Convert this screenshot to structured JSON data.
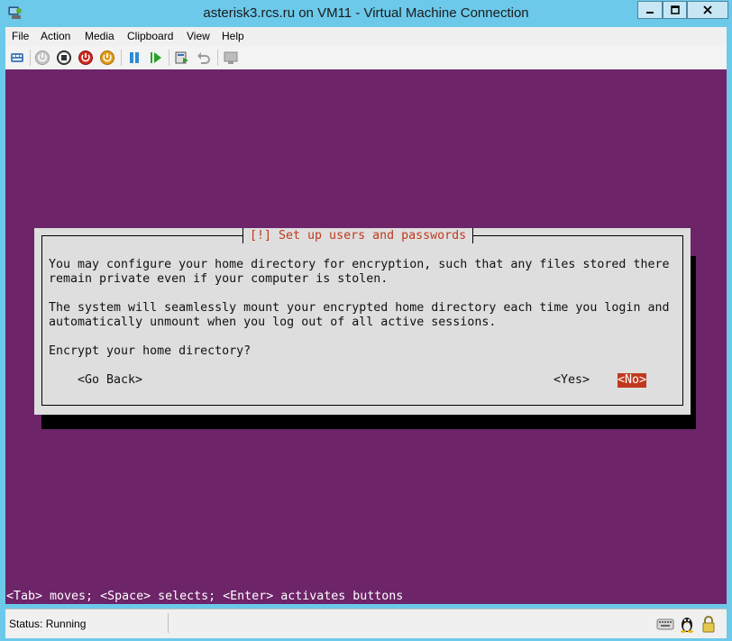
{
  "window": {
    "title": "asterisk3.rcs.ru on VM11 - Virtual Machine Connection"
  },
  "menu": [
    "File",
    "Action",
    "Media",
    "Clipboard",
    "View",
    "Help"
  ],
  "toolbar": {
    "icons": [
      "ctrl-alt-del-icon",
      "start-icon",
      "turn-off-icon",
      "shut-down-icon",
      "save-icon",
      "pause-icon",
      "reset-icon",
      "checkpoint-icon",
      "revert-icon",
      "enhanced-session-icon"
    ]
  },
  "dialog": {
    "title": "[!] Set up users and passwords",
    "paragraph1_line1": "You may configure your home directory for encryption, such that any files stored there",
    "paragraph1_line2": "remain private even if your computer is stolen.",
    "paragraph2_line1": "The system will seamlessly mount your encrypted home directory each time you login and",
    "paragraph2_line2": "automatically unmount when you log out of all active sessions.",
    "question": "Encrypt your home directory?",
    "go_back": "<Go Back>",
    "yes": "<Yes>",
    "no": "<No>"
  },
  "terminal_hint": "<Tab> moves; <Space> selects; <Enter> activates buttons",
  "status": {
    "text": "Status: Running",
    "icons": [
      "keyboard-icon",
      "linux-tux-icon",
      "lock-icon"
    ]
  },
  "colors": {
    "vm_background": "#6d2468",
    "dialog_background": "#dedede",
    "accent_red": "#c0391f",
    "window_frame": "#6cc9ea"
  }
}
